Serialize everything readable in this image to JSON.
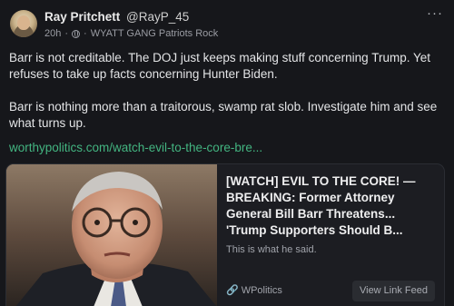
{
  "post": {
    "author_name": "Ray Pritchett",
    "author_handle": "@RayP_45",
    "time": "20h",
    "separator": "·",
    "group": "WYATT GANG Patriots Rock",
    "more_label": "···",
    "paragraph1": "Barr is not creditable. The DOJ just keeps making stuff concerning Trump. Yet refuses to take up facts concerning Hunter Biden.",
    "paragraph2": "Barr is nothing more than a traitorous, swamp rat slob. Investigate him and see what turns up.",
    "link_text": "worthypolitics.com/watch-evil-to-the-core-bre..."
  },
  "card": {
    "title": "[WATCH] EVIL TO THE CORE! — BREAKING: Former Attorney General Bill Barr Threatens... 'Trump Supporters Should B...",
    "description": "This is what he said.",
    "source": "WPolitics",
    "view_button": "View Link Feed"
  },
  "icons": {
    "avatar": "avatar",
    "globe": "globe-icon",
    "more": "more-icon",
    "link": "link-icon"
  }
}
